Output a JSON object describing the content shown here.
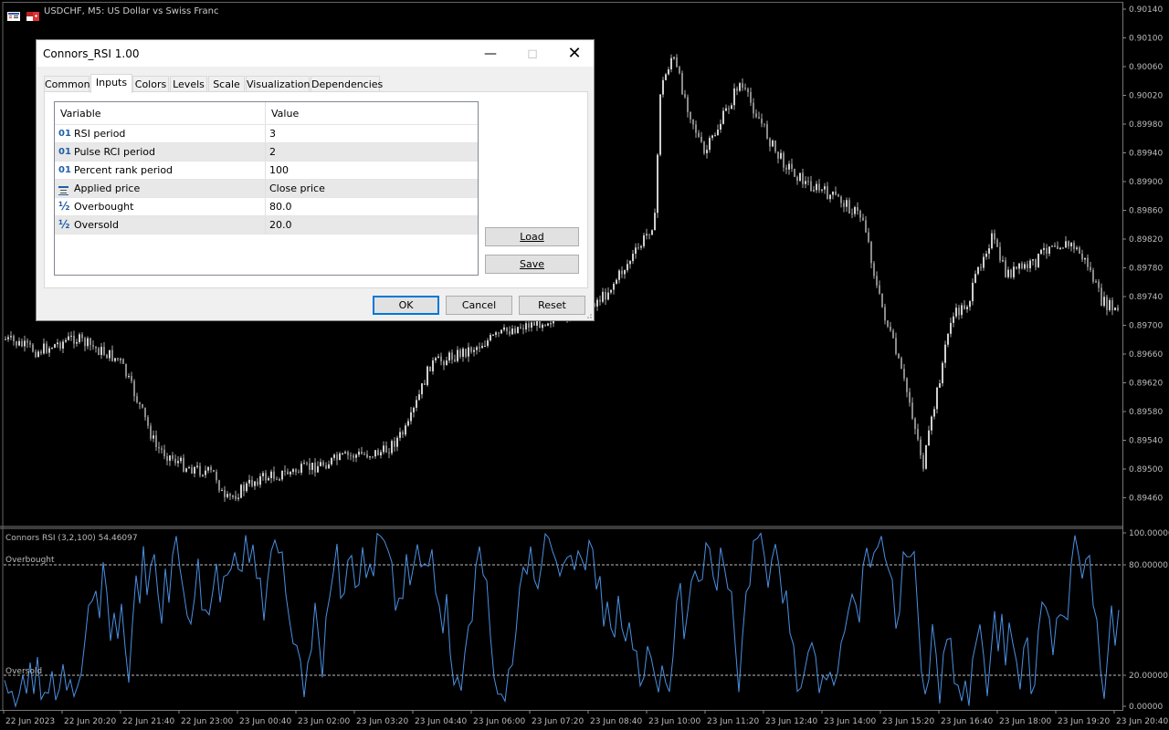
{
  "chart_title": "USDCHF, M5:  US Dollar vs Swiss Franc",
  "price_axis": [
    "0.90140",
    "0.90100",
    "0.90060",
    "0.90020",
    "0.89980",
    "0.89940",
    "0.89900",
    "0.89860",
    "0.89820",
    "0.89780",
    "0.89740",
    "0.89700",
    "0.89660",
    "0.89620",
    "0.89580",
    "0.89540",
    "0.89500",
    "0.89460"
  ],
  "indicator": {
    "label": "Connors RSI (3,2,100) 54.46097",
    "axis": [
      "100.00000",
      "80.00000",
      "20.00000",
      "0.00000"
    ],
    "overbought_label": "Overbought",
    "oversold_label": "Oversold",
    "line_color": "#4a90e2"
  },
  "time_axis": [
    "22 Jun 2023",
    "22 Jun 20:20",
    "22 Jun 21:40",
    "22 Jun 23:00",
    "23 Jun 00:40",
    "23 Jun 02:00",
    "23 Jun 03:20",
    "23 Jun 04:40",
    "23 Jun 06:00",
    "23 Jun 07:20",
    "23 Jun 08:40",
    "23 Jun 10:00",
    "23 Jun 11:20",
    "23 Jun 12:40",
    "23 Jun 14:00",
    "23 Jun 15:20",
    "23 Jun 16:40",
    "23 Jun 18:00",
    "23 Jun 19:20",
    "23 Jun 20:40"
  ],
  "dialog": {
    "title": "Connors_RSI 1.00",
    "tabs": [
      "Common",
      "Inputs",
      "Colors",
      "Levels",
      "Scale",
      "Visualization",
      "Dependencies"
    ],
    "active_tab": "Inputs",
    "columns": [
      "Variable",
      "Value"
    ],
    "rows": [
      {
        "icon": "01",
        "variable": "RSI period",
        "value": "3"
      },
      {
        "icon": "01",
        "variable": "Pulse RCI period",
        "value": "2"
      },
      {
        "icon": "01",
        "variable": "Percent rank period",
        "value": "100"
      },
      {
        "icon": "list",
        "variable": "Applied price",
        "value": "Close price"
      },
      {
        "icon": "½",
        "variable": "Overbought",
        "value": "80.0"
      },
      {
        "icon": "½",
        "variable": "Oversold",
        "value": "20.0"
      }
    ],
    "load_label": "Load",
    "save_label": "Save",
    "ok_label": "OK",
    "cancel_label": "Cancel",
    "reset_label": "Reset"
  }
}
